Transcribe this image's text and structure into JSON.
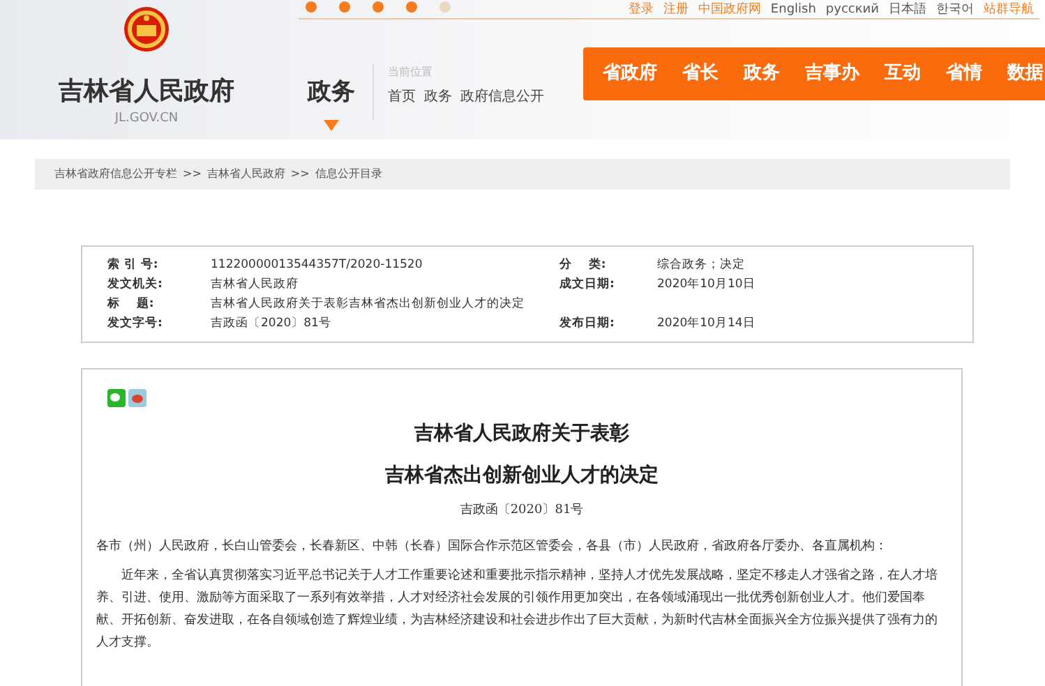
{
  "top_links": [
    {
      "label": "登录",
      "kind": "accent"
    },
    {
      "label": "注册",
      "kind": "accent"
    },
    {
      "label": "中国政府网",
      "kind": "accent"
    },
    {
      "label": "English",
      "kind": "plain"
    },
    {
      "label": "русский",
      "kind": "plain"
    },
    {
      "label": "日本語",
      "kind": "plain"
    },
    {
      "label": "한국어",
      "kind": "plain"
    },
    {
      "label": "站群导航",
      "kind": "accent"
    }
  ],
  "site": {
    "title": "吉林省人民政府",
    "domain": "JL.GOV.CN",
    "section": "政务"
  },
  "location": {
    "label": "当前位置",
    "crumbs": [
      "首页",
      "政务",
      "政府信息公开"
    ]
  },
  "nav": [
    "省政府",
    "省长",
    "政务",
    "吉事办",
    "互动",
    "省情",
    "数据"
  ],
  "breadcrumb": [
    "吉林省政府信息公开专栏",
    ">>",
    "吉林省人民政府",
    ">>",
    "信息公开目录"
  ],
  "meta": [
    {
      "label": "索 引 号:",
      "value": "11220000013544357T/2020-11520",
      "label2": "分    类:",
      "value2": "综合政务；决定"
    },
    {
      "label": "发文机关:",
      "value": "吉林省人民政府",
      "label2": "成文日期:",
      "value2": "2020年10月10日"
    },
    {
      "label": "标    题:",
      "value": "吉林省人民政府关于表彰吉林省杰出创新创业人才的决定"
    },
    {
      "label": "发文字号:",
      "value": "吉政函〔2020〕81号",
      "label2": "发布日期:",
      "value2": "2020年10月14日"
    }
  ],
  "article": {
    "title_lines": [
      "吉林省人民政府关于表彰",
      "吉林省杰出创新创业人才的决定"
    ],
    "doc_number": "吉政函〔2020〕81号",
    "paragraphs": [
      {
        "kind": "salutation",
        "text": "各市（州）人民政府，长白山管委会，长春新区、中韩（长春）国际合作示范区管委会，各县（市）人民政府，省政府各厅委办、各直属机构："
      },
      {
        "kind": "body",
        "text": "近年来，全省认真贯彻落实习近平总书记关于人才工作重要论述和重要批示指示精神，坚持人才优先发展战略，坚定不移走人才强省之路，在人才培养、引进、使用、激励等方面采取了一系列有效举措，人才对经济社会发展的引领作用更加突出，在各领域涌现出一批优秀创新创业人才。他们爱国奉献、开拓创新、奋发进取，在各自领域创造了辉煌业绩，为吉林经济建设和社会进步作出了巨大贡献，为新时代吉林全面振兴全方位振兴提供了强有力的人才支撑。"
      }
    ]
  }
}
